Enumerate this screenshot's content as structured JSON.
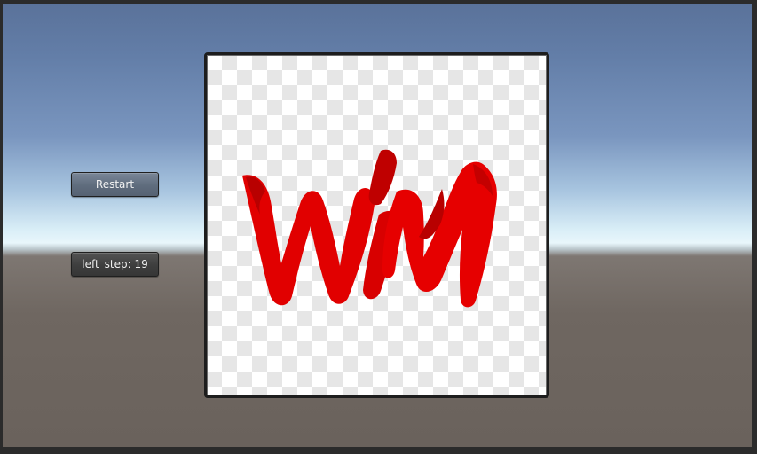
{
  "controls": {
    "restart_label": "Restart",
    "left_step_label": "left_step: 19"
  },
  "colors": {
    "win_red": "#e10000",
    "win_dark_red": "#b80000"
  },
  "image": {
    "subject": "WIN"
  }
}
